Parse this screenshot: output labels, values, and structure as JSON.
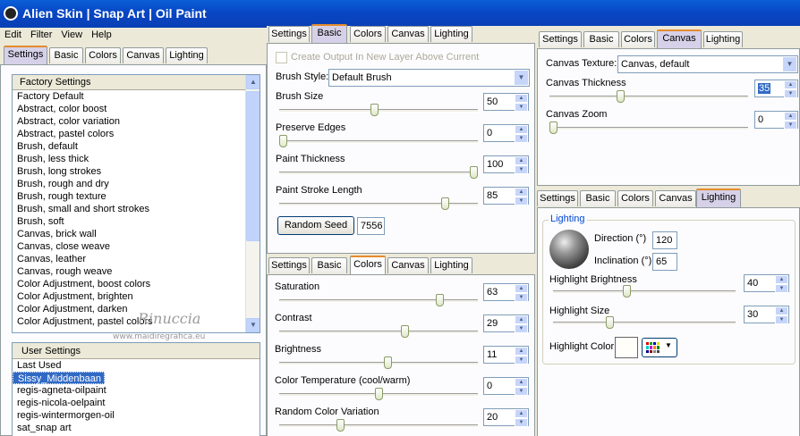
{
  "app": {
    "title": "Alien Skin  |  Snap Art  |  Oil Paint"
  },
  "menu": [
    "Edit",
    "Filter",
    "View",
    "Help"
  ],
  "left_tabs": [
    "Settings",
    "Basic",
    "Colors",
    "Canvas",
    "Lighting"
  ],
  "factory": {
    "header": "Factory Settings",
    "items": [
      "Factory Default",
      "Abstract, color boost",
      "Abstract, color variation",
      "Abstract, pastel colors",
      "Brush, default",
      "Brush, less thick",
      "Brush, long strokes",
      "Brush, rough and dry",
      "Brush, rough texture",
      "Brush, small and short strokes",
      "Brush, soft",
      "Canvas, brick wall",
      "Canvas, close weave",
      "Canvas, leather",
      "Canvas, rough weave",
      "Color Adjustment, boost colors",
      "Color Adjustment, brighten",
      "Color Adjustment, darken",
      "Color Adjustment, pastel colors"
    ]
  },
  "user": {
    "header": "User Settings",
    "items": [
      "Last Used",
      "Sissy_Middenbaan",
      "regis-agneta-oilpaint",
      "regis-nicola-oelpaint",
      "regis-wintermorgen-oil",
      "sat_snap art"
    ]
  },
  "watermark": {
    "name": "Rinuccia",
    "url": "www.maidiregrafica.eu"
  },
  "basic": {
    "tabs": [
      "Settings",
      "Basic",
      "Colors",
      "Canvas",
      "Lighting"
    ],
    "create_output_label": "Create Output In New Layer Above Current",
    "brush_style_label": "Brush Style:",
    "brush_style_value": "Default Brush",
    "sliders": [
      {
        "label": "Brush Size",
        "value": "50",
        "fraction": 0.48
      },
      {
        "label": "Preserve Edges",
        "value": "0",
        "fraction": 0.0
      },
      {
        "label": "Paint Thickness",
        "value": "100",
        "fraction": 1.0
      },
      {
        "label": "Paint Stroke Length",
        "value": "85",
        "fraction": 0.85
      }
    ],
    "random_seed_label": "Random Seed",
    "random_seed_value": "7556"
  },
  "colors": {
    "tabs": [
      "Settings",
      "Basic",
      "Colors",
      "Canvas",
      "Lighting"
    ],
    "sliders": [
      {
        "label": "Saturation",
        "value": "63",
        "fraction": 0.82
      },
      {
        "label": "Contrast",
        "value": "29",
        "fraction": 0.64
      },
      {
        "label": "Brightness",
        "value": "11",
        "fraction": 0.55
      },
      {
        "label": "Color Temperature (cool/warm)",
        "value": "0",
        "fraction": 0.5
      },
      {
        "label": "Random Color Variation",
        "value": "20",
        "fraction": 0.3
      }
    ]
  },
  "canvas": {
    "tabs": [
      "Settings",
      "Basic",
      "Colors",
      "Canvas",
      "Lighting"
    ],
    "texture_label": "Canvas Texture:",
    "texture_value": "Canvas, default",
    "sliders": [
      {
        "label": "Canvas Thickness",
        "value": "35",
        "fraction": 0.35
      },
      {
        "label": "Canvas Zoom",
        "value": "0",
        "fraction": 0.0
      }
    ]
  },
  "lighting": {
    "tabs": [
      "Settings",
      "Basic",
      "Colors",
      "Canvas",
      "Lighting"
    ],
    "group_label": "Lighting",
    "direction_label": "Direction (°)",
    "direction_value": "120",
    "inclination_label": "Inclination (°)",
    "inclination_value": "65",
    "sliders": [
      {
        "label": "Highlight Brightness",
        "value": "40",
        "fraction": 0.4
      },
      {
        "label": "Highlight Size",
        "value": "30",
        "fraction": 0.3
      }
    ],
    "highlight_color_label": "Highlight Color"
  }
}
